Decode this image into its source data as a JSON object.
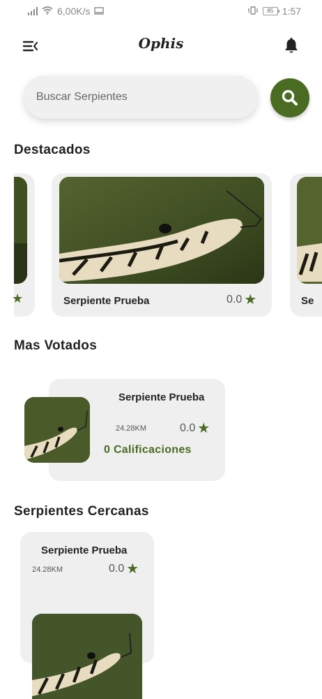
{
  "status_bar": {
    "speed": "6,00K/s",
    "battery": "85",
    "time": "1:57"
  },
  "app_bar": {
    "title": "Ophis",
    "menu_icon": "menu-collapse-icon",
    "bell_icon": "bell-icon"
  },
  "search": {
    "placeholder": "Buscar Serpientes",
    "button_icon": "search-icon"
  },
  "featured": {
    "title": "Destacados",
    "card": {
      "name": "Serpiente Prueba",
      "rating": "0.0"
    },
    "peek_right_text": "Se"
  },
  "most_voted": {
    "title": "Mas Votados",
    "card": {
      "name": "Serpiente Prueba",
      "distance": "24.28KM",
      "rating": "0.0",
      "ratings_count": "0 Calificaciones"
    }
  },
  "nearby": {
    "title": "Serpientes Cercanas",
    "card": {
      "name": "Serpiente Prueba",
      "distance": "24.28KM",
      "rating": "0.0"
    }
  },
  "colors": {
    "accent": "#4a6b22",
    "card_bg": "#efefef",
    "text": "#222222"
  }
}
